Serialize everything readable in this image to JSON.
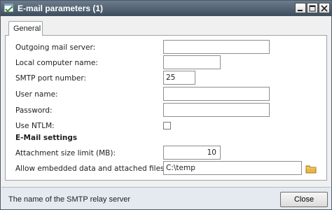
{
  "window": {
    "title": "E-mail parameters (1)"
  },
  "tabs": [
    {
      "label": "General"
    }
  ],
  "fields": {
    "outgoing_server": {
      "label": "Outgoing mail server:",
      "value": ""
    },
    "local_computer": {
      "label": "Local computer name:",
      "value": ""
    },
    "smtp_port": {
      "label": "SMTP port number:",
      "value": "25"
    },
    "user_name": {
      "label": "User name:",
      "value": ""
    },
    "password": {
      "label": "Password:",
      "value": ""
    },
    "use_ntlm": {
      "label": "Use NTLM:",
      "checked": false
    }
  },
  "email_settings": {
    "heading": "E-Mail settings",
    "attachment_limit": {
      "label": "Attachment size limit (MB):",
      "value": "10"
    },
    "embedded_from": {
      "label": "Allow embedded data and attached files from:",
      "value": "C:\\temp"
    }
  },
  "status": {
    "text": "The name of the SMTP relay server"
  },
  "buttons": {
    "close": "Close"
  },
  "icons": {
    "app": "form-icon",
    "folder": "folder-icon",
    "minimize": "minimize-icon",
    "maximize": "maximize-icon",
    "close": "close-icon"
  }
}
